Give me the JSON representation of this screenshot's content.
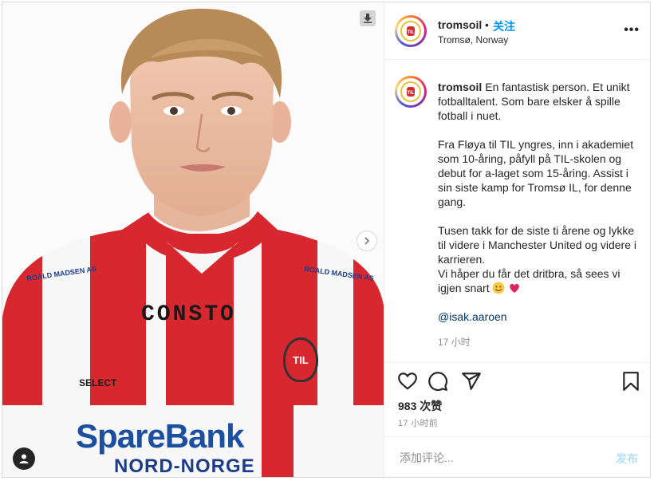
{
  "post": {
    "username": "tromsoil",
    "dot": "•",
    "follow_label": "关注",
    "location": "Tromsø, Norway",
    "more_label": "•••"
  },
  "media": {
    "jersey_sponsor": "CONSTO",
    "shoulder_sponsor": "ROALD MADSEN AS",
    "bank_line1": "SpareBank",
    "bank_line2": "NORD-NORGE",
    "kit_brand": "SELECT",
    "crest_text": "TIL"
  },
  "caption": {
    "username": "tromsoil",
    "paragraph1": "En fantastisk person. Et unikt fotballtalent. Som bare elsker å spille fotball i nuet.",
    "paragraph2": "Fra Fløya til TIL yngres, inn i akademiet som 10-åring, påfyll på TIL-skolen og debut for a-laget som 15-åring. Assist i sin siste kamp for Tromsø IL, for denne gang.",
    "paragraph3a": "Tusen takk for de siste ti årene og lykke til videre i Manchester United og videre i karrieren.",
    "paragraph3b": "Vi håper du får det dritbra, så sees vi igjen snart ",
    "mention": "@isak.aaroen",
    "time": "17 小时"
  },
  "stats": {
    "likes": "983 次赞",
    "time": "17 小时前"
  },
  "comment_box": {
    "placeholder": "添加评论...",
    "post_label": "发布"
  },
  "colors": {
    "accent_blue": "#0095f6",
    "post_disabled": "#b2dffc",
    "jersey_red": "#d7282f",
    "heart": "#e0245e"
  },
  "icons": [
    "download-icon",
    "chevron-right-icon",
    "user-tag-icon",
    "more-icon",
    "heart-icon",
    "comment-icon",
    "share-icon",
    "bookmark-icon",
    "smile-emoji-icon",
    "red-heart-emoji-icon"
  ]
}
